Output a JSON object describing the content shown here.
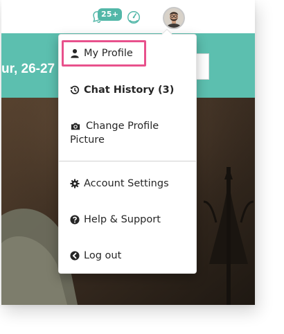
{
  "topbar": {
    "notifications": {
      "icon": "bell-icon",
      "badge": "25+"
    },
    "activity_icon": "gauge-icon",
    "avatar": "avatar"
  },
  "banner": {
    "title": "ur, 26-27",
    "color": "#5cbfaf"
  },
  "menu": {
    "items": [
      {
        "label": "My Profile",
        "icon": "user-icon",
        "highlighted": true
      },
      {
        "label": "Chat History (3)",
        "icon": "history-icon",
        "bold": true
      },
      {
        "label": "Change Profile",
        "label2": "Picture",
        "icon": "camera-icon"
      },
      {
        "label": "Account Settings",
        "icon": "gear-icon"
      },
      {
        "label": "Help & Support",
        "icon": "question-circle-icon"
      },
      {
        "label": "Log out",
        "icon": "arrow-left-circle-icon"
      }
    ]
  },
  "colors": {
    "accent": "#52b7a8",
    "highlight_border": "#e8518c",
    "text": "#262626"
  }
}
